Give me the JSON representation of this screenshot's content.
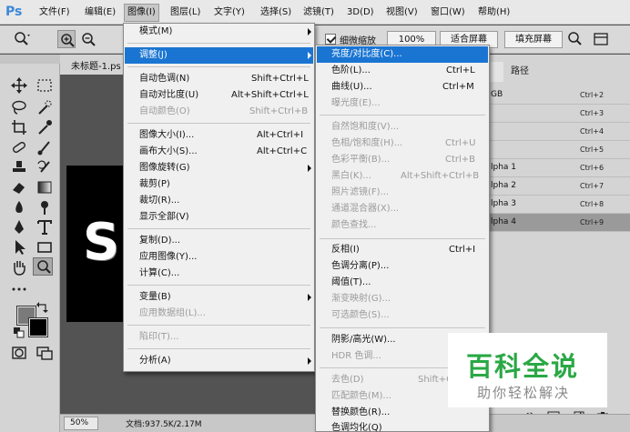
{
  "app": {
    "logo": "Ps"
  },
  "menubar": {
    "items": [
      "文件(F)",
      "编辑(E)",
      "图像(I)",
      "图层(L)",
      "文字(Y)",
      "选择(S)",
      "滤镜(T)",
      "3D(D)",
      "视图(V)",
      "窗口(W)",
      "帮助(H)"
    ],
    "active": "图像(I)"
  },
  "options": {
    "scrubby_zoom_checked": true,
    "scrubby_zoom_label": "细微缩放",
    "zoom_100": "100%",
    "fit_screen": "适合屏幕",
    "fill_screen": "填充屏幕"
  },
  "document": {
    "tab_label": "未标题-1.ps",
    "canvas_letter": "S",
    "zoom": "50%",
    "info": "文档:937.5K/2.17M"
  },
  "image_menu": {
    "items": [
      {
        "label": "模式(M)",
        "shortcut": "",
        "submenu": true,
        "disabled": false
      },
      {
        "label": "调整(J)",
        "shortcut": "",
        "submenu": true,
        "disabled": false,
        "highlighted": true
      },
      {
        "label": "自动色调(N)",
        "shortcut": "Shift+Ctrl+L",
        "disabled": false
      },
      {
        "label": "自动对比度(U)",
        "shortcut": "Alt+Shift+Ctrl+L",
        "disabled": false
      },
      {
        "label": "自动颜色(O)",
        "shortcut": "Shift+Ctrl+B",
        "disabled": true
      },
      {
        "label": "图像大小(I)...",
        "shortcut": "Alt+Ctrl+I",
        "disabled": false
      },
      {
        "label": "画布大小(S)...",
        "shortcut": "Alt+Ctrl+C",
        "disabled": false
      },
      {
        "label": "图像旋转(G)",
        "shortcut": "",
        "submenu": true,
        "disabled": false
      },
      {
        "label": "裁剪(P)",
        "shortcut": "",
        "disabled": false
      },
      {
        "label": "裁切(R)...",
        "shortcut": "",
        "disabled": false
      },
      {
        "label": "显示全部(V)",
        "shortcut": "",
        "disabled": false
      },
      {
        "label": "复制(D)...",
        "shortcut": "",
        "disabled": false
      },
      {
        "label": "应用图像(Y)...",
        "shortcut": "",
        "disabled": false
      },
      {
        "label": "计算(C)...",
        "shortcut": "",
        "disabled": false
      },
      {
        "label": "变量(B)",
        "shortcut": "",
        "submenu": true,
        "disabled": false
      },
      {
        "label": "应用数据组(L)...",
        "shortcut": "",
        "disabled": true
      },
      {
        "label": "陷印(T)...",
        "shortcut": "",
        "disabled": true
      },
      {
        "label": "分析(A)",
        "shortcut": "",
        "submenu": true,
        "disabled": false
      }
    ]
  },
  "adjust_menu": {
    "items": [
      {
        "label": "亮度/对比度(C)...",
        "shortcut": "",
        "disabled": false,
        "highlighted": true
      },
      {
        "label": "色阶(L)...",
        "shortcut": "Ctrl+L",
        "disabled": false
      },
      {
        "label": "曲线(U)...",
        "shortcut": "Ctrl+M",
        "disabled": false
      },
      {
        "label": "曝光度(E)...",
        "shortcut": "",
        "disabled": true
      },
      {
        "label": "自然饱和度(V)...",
        "shortcut": "",
        "disabled": true
      },
      {
        "label": "色相/饱和度(H)...",
        "shortcut": "Ctrl+U",
        "disabled": true
      },
      {
        "label": "色彩平衡(B)...",
        "shortcut": "Ctrl+B",
        "disabled": true
      },
      {
        "label": "黑白(K)...",
        "shortcut": "Alt+Shift+Ctrl+B",
        "disabled": true
      },
      {
        "label": "照片滤镜(F)...",
        "shortcut": "",
        "disabled": true
      },
      {
        "label": "通道混合器(X)...",
        "shortcut": "",
        "disabled": true
      },
      {
        "label": "颜色查找...",
        "shortcut": "",
        "disabled": true
      },
      {
        "label": "反相(I)",
        "shortcut": "Ctrl+I",
        "disabled": false
      },
      {
        "label": "色调分离(P)...",
        "shortcut": "",
        "disabled": false
      },
      {
        "label": "阈值(T)...",
        "shortcut": "",
        "disabled": false
      },
      {
        "label": "渐变映射(G)...",
        "shortcut": "",
        "disabled": true
      },
      {
        "label": "可选颜色(S)...",
        "shortcut": "",
        "disabled": true
      },
      {
        "label": "阴影/高光(W)...",
        "shortcut": "",
        "disabled": false
      },
      {
        "label": "HDR 色调...",
        "shortcut": "",
        "disabled": true
      },
      {
        "label": "去色(D)",
        "shortcut": "Shift+C",
        "disabled": true
      },
      {
        "label": "匹配颜色(M)...",
        "shortcut": "",
        "disabled": true
      },
      {
        "label": "替换颜色(R)...",
        "shortcut": "",
        "disabled": false
      },
      {
        "label": "色调均化(Q)",
        "shortcut": "",
        "disabled": false
      }
    ]
  },
  "channels_panel": {
    "tab_paths": "路径",
    "rows": [
      {
        "name": "GB",
        "shortcut": "Ctrl+2",
        "selected": false
      },
      {
        "name": "",
        "shortcut": "Ctrl+3",
        "selected": false
      },
      {
        "name": "",
        "shortcut": "Ctrl+4",
        "selected": false
      },
      {
        "name": "",
        "shortcut": "Ctrl+5",
        "selected": false
      },
      {
        "name": "lpha 1",
        "shortcut": "Ctrl+6",
        "selected": false
      },
      {
        "name": "lpha 2",
        "shortcut": "Ctrl+7",
        "selected": false
      },
      {
        "name": "lpha 3",
        "shortcut": "Ctrl+8",
        "selected": false
      },
      {
        "name": "lpha 4",
        "shortcut": "Ctrl+9",
        "selected": true
      }
    ]
  },
  "watermark": {
    "title": "百科全说",
    "subtitle": "助你轻松解决"
  },
  "colors": {
    "menu_highlight": "#1a75d2",
    "watermark_green": "#2aa845"
  }
}
